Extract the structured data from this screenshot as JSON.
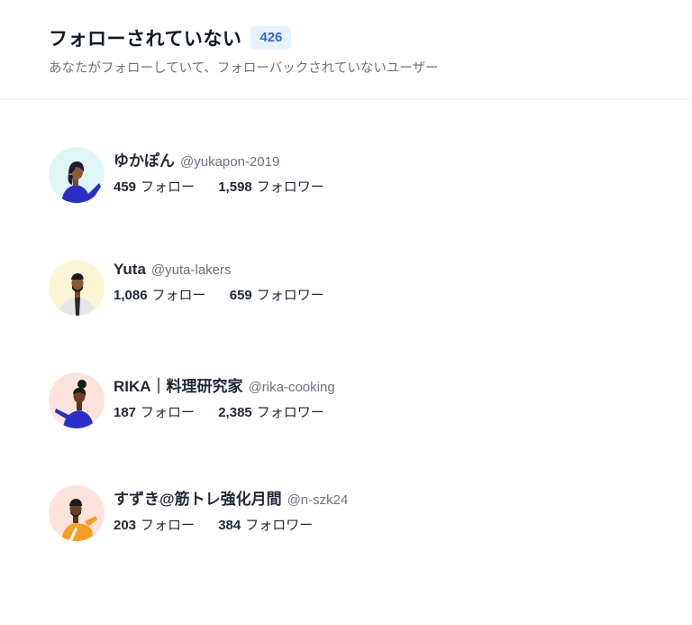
{
  "header": {
    "title": "フォローされていない",
    "count": "426",
    "subtitle": "あなたがフォローしていて、フォローバックされていないユーザー"
  },
  "users": [
    {
      "name": "ゆかぽん",
      "handle": "@yukapon-2019",
      "following": "459",
      "following_label": "フォロー",
      "followers": "1,598",
      "followers_label": "フォロワー",
      "avatar_bg": "#dff7f4"
    },
    {
      "name": "Yuta",
      "handle": "@yuta-lakers",
      "following": "1,086",
      "following_label": "フォロー",
      "followers": "659",
      "followers_label": "フォロワー",
      "avatar_bg": "#fdf6d6"
    },
    {
      "name": "RIKA｜料理研究家",
      "handle": "@rika-cooking",
      "following": "187",
      "following_label": "フォロー",
      "followers": "2,385",
      "followers_label": "フォロワー",
      "avatar_bg": "#fde3dc"
    },
    {
      "name": "すずき@筋トレ強化月間",
      "handle": "@n-szk24",
      "following": "203",
      "following_label": "フォロー",
      "followers": "384",
      "followers_label": "フォロワー",
      "avatar_bg": "#fde3dc"
    }
  ]
}
